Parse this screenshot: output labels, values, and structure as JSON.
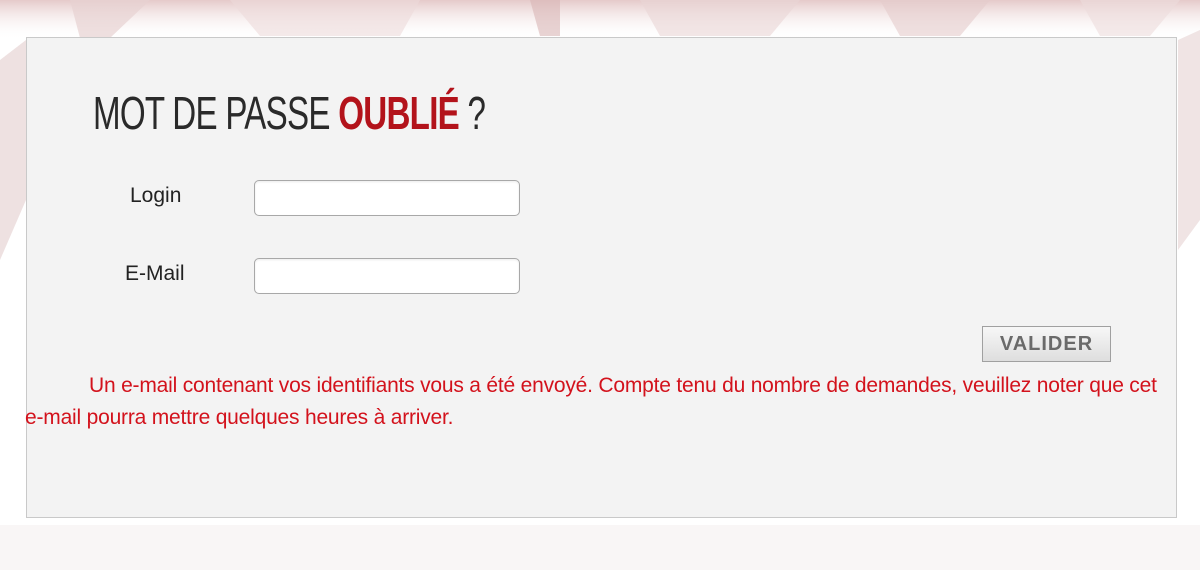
{
  "form": {
    "title_main": "MOT DE PASSE",
    "title_accent": "OUBLIÉ",
    "title_end": "?",
    "login_label": "Login",
    "login_value": "",
    "email_label": "E-Mail",
    "email_value": "",
    "submit_label": "VALIDER"
  },
  "message": {
    "text": "Un e-mail contenant vos identifiants vous a été envoyé. Compte tenu du nombre de demandes, veuillez noter que cet e-mail pourra mettre quelques heures à arriver."
  },
  "colors": {
    "accent": "#b3131b",
    "message": "#d3121c",
    "panel_bg": "#f3f3f3",
    "panel_border": "#c9c9c9"
  }
}
